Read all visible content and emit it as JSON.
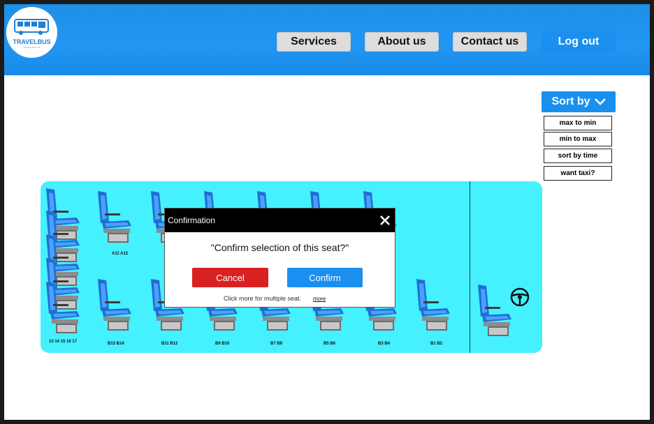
{
  "brand": {
    "name": "TRAVELBUS",
    "tagline": "TRAVEL WITH US"
  },
  "nav": {
    "services": "Services",
    "about": "About us",
    "contact": "Contact us",
    "logout": "Log out"
  },
  "sort": {
    "label": "Sort by",
    "options": [
      "max to min",
      "min to max",
      "sort by time",
      "want taxi?"
    ]
  },
  "seats": {
    "labels": [
      "13 14 15 16 17",
      "B13 B14",
      "B11 B12",
      "B9 B10",
      "B7 B8",
      "B5 B6",
      "B3 B4",
      "B1 B2",
      "A11 A12"
    ]
  },
  "dialog": {
    "title": "Confirmation",
    "question": "\"Confirm selection of this seat?\"",
    "cancel": "Cancel",
    "confirm": "Confirm",
    "hint": "Click more for multiple seat.",
    "more": "more"
  },
  "colors": {
    "primary": "#1a8fef",
    "bus": "#45f0ff",
    "danger": "#d92121",
    "seat": "#1f6fd0"
  }
}
